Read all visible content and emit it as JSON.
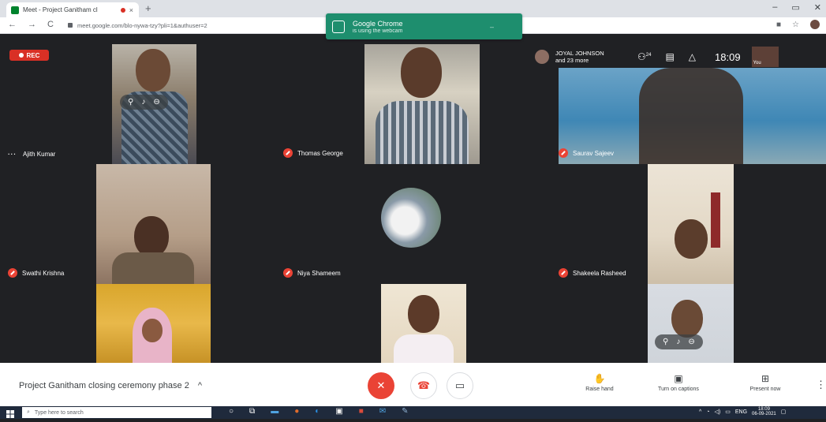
{
  "browser": {
    "tab_title": "Meet - Project Ganitham cl",
    "new_tab": "+",
    "close_tab": "×",
    "url": "meet.google.com/blo-nywa-tzy?pli=1&authuser=2",
    "window_controls": [
      "–",
      "▭",
      "✕"
    ]
  },
  "notification": {
    "title": "Google Chrome",
    "subtitle": "is using the webcam"
  },
  "meeting": {
    "rec_label": "REC",
    "host_label": "JOYAL JOHNSON",
    "host_sub": "and 23 more",
    "people_count": "24",
    "time": "18:09",
    "self_label": "You",
    "title": "Project Ganitham closing ceremony phase 2",
    "title_toggle": "^"
  },
  "participants": [
    {
      "name": "Ajith Kumar",
      "muted": false
    },
    {
      "name": "Thomas George",
      "muted": true
    },
    {
      "name": "Saurav Sajeev",
      "muted": true
    },
    {
      "name": "Swathi Krishna",
      "muted": true
    },
    {
      "name": "Niya Shameem",
      "muted": true
    },
    {
      "name": "Shakeela Rasheed",
      "muted": true
    },
    {
      "name": "",
      "muted": false
    },
    {
      "name": "",
      "muted": false
    },
    {
      "name": "",
      "muted": false
    }
  ],
  "actions": {
    "raise_hand": "Raise hand",
    "captions": "Turn on captions",
    "present": "Present now"
  },
  "taskbar": {
    "search_placeholder": "Type here to search",
    "lang": "ENG",
    "clock_time": "18:09",
    "clock_date": "06-09-2021"
  },
  "colors": {
    "meet_bg": "#202124",
    "mute_red": "#ea4335",
    "notification_green": "#1e8e6e",
    "rec_red": "#d93025"
  }
}
